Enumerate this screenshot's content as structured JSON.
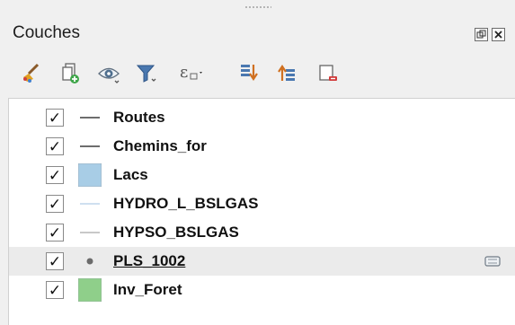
{
  "panel": {
    "title": "Couches",
    "float_icon": "float-window-icon",
    "close_icon": "close-icon"
  },
  "toolbar": {
    "icons": [
      "style-brush-icon",
      "add-group-icon",
      "visibility-eye-icon",
      "filter-legend-icon",
      "filter-expression-icon",
      "expand-all-icon",
      "collapse-all-icon",
      "remove-layer-icon"
    ]
  },
  "layers": [
    {
      "name": "Routes",
      "checked": true,
      "symbol": "line",
      "color": "#6d6d6d"
    },
    {
      "name": "Chemins_for",
      "checked": true,
      "symbol": "line",
      "color": "#6d6d6d"
    },
    {
      "name": "Lacs",
      "checked": true,
      "symbol": "fill",
      "color": "#a8cde6"
    },
    {
      "name": "HYDRO_L_BSLGAS",
      "checked": true,
      "symbol": "line",
      "color": "#cfe0f0"
    },
    {
      "name": "HYPSO_BSLGAS",
      "checked": true,
      "symbol": "line",
      "color": "#c8c8c8"
    },
    {
      "name": "PLS_1002",
      "checked": true,
      "symbol": "point",
      "color": "#6b6b6b",
      "selected": true,
      "indicator": "embedded-layer-icon"
    },
    {
      "name": "Inv_Foret",
      "checked": true,
      "symbol": "fill",
      "color": "#8fcf8a"
    }
  ],
  "checkmark": "✓"
}
